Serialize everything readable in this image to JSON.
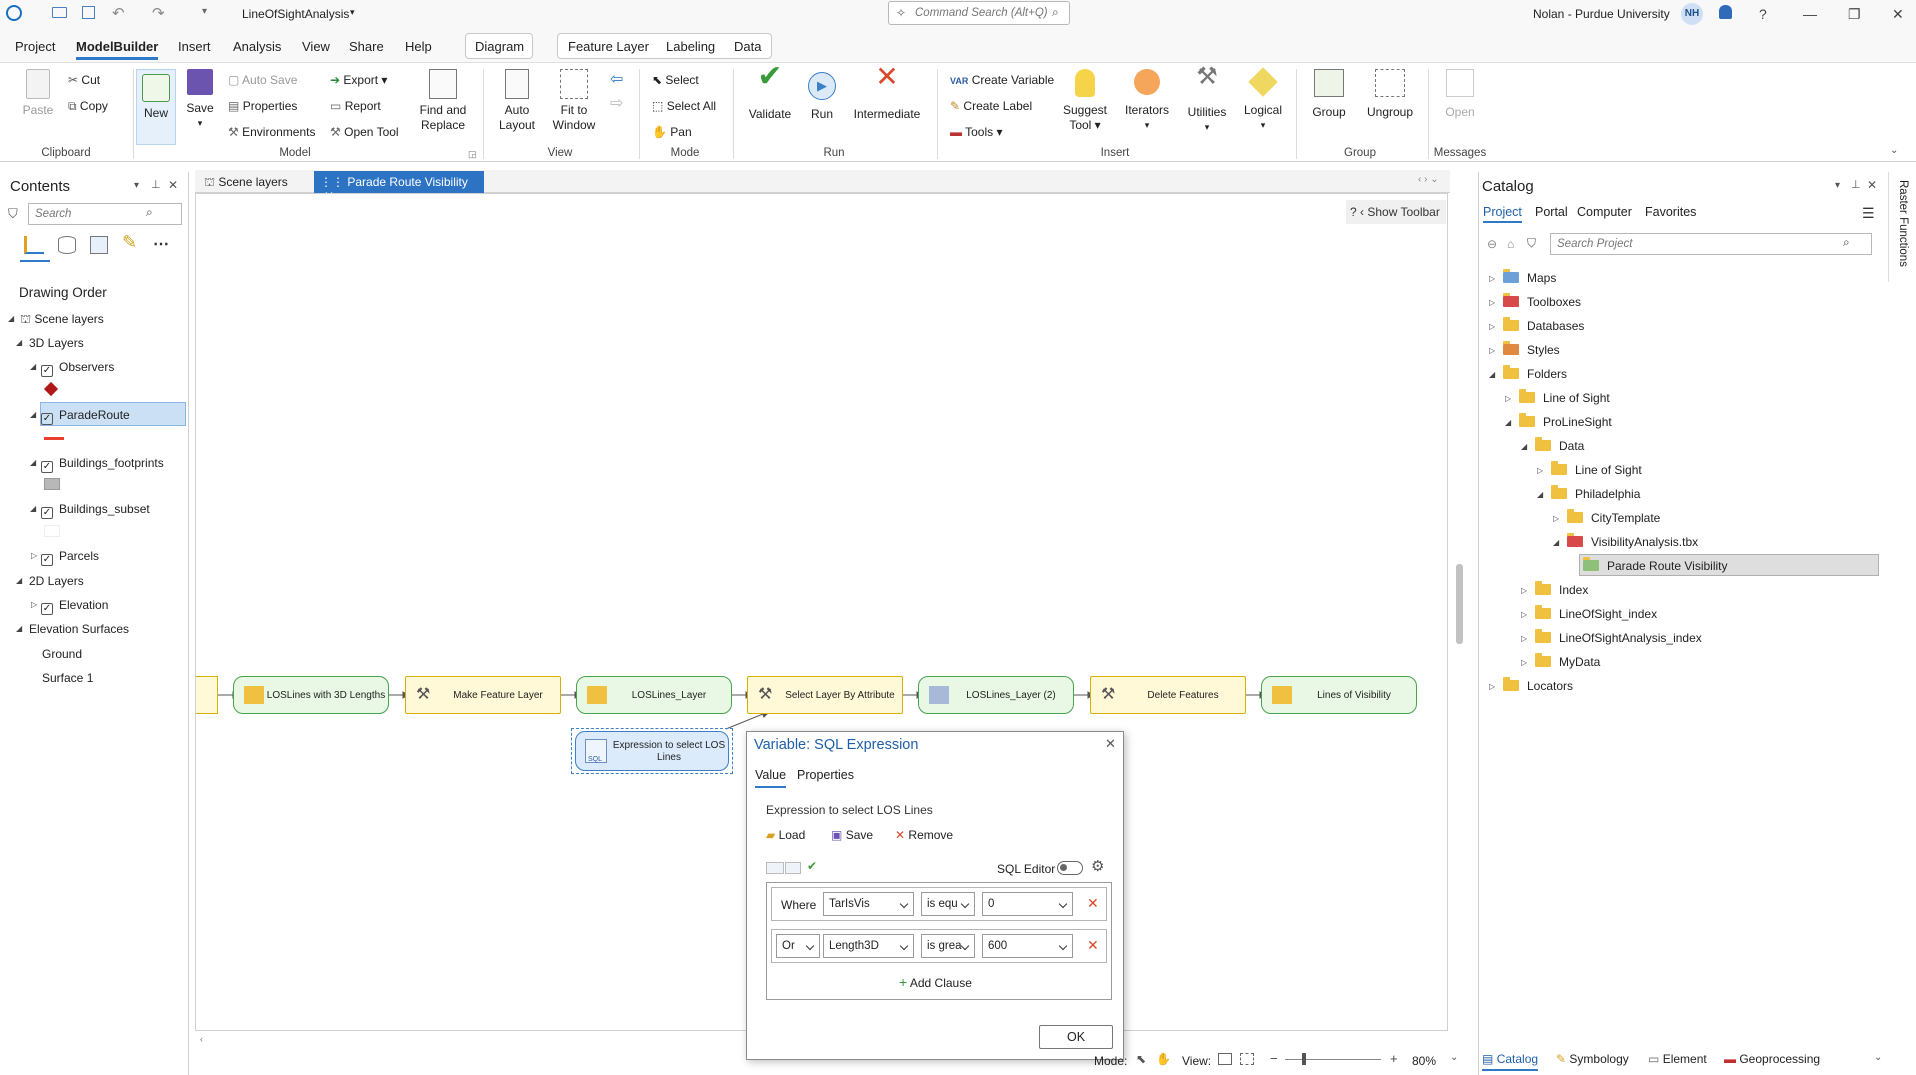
{
  "title": {
    "project": "LineOfSightAnalysis",
    "search_placeholder": "Command Search (Alt+Q)",
    "user": "Nolan - Purdue University",
    "initials": "NH"
  },
  "menus": [
    "Project",
    "ModelBuilder",
    "Insert",
    "Analysis",
    "View",
    "Share",
    "Help"
  ],
  "context_tabs": {
    "diagram": "Diagram",
    "feature_layer": "Feature Layer",
    "labeling": "Labeling",
    "data": "Data"
  },
  "ribbon": {
    "paste": "Paste",
    "cut": "Cut",
    "copy": "Copy",
    "clipboard": "Clipboard",
    "new": "New",
    "save": "Save",
    "auto_save": "Auto Save",
    "properties": "Properties",
    "environments": "Environments",
    "export": "Export",
    "report": "Report",
    "open_tool": "Open Tool",
    "find_replace_1": "Find and",
    "find_replace_2": "Replace",
    "model": "Model",
    "auto_layout_1": "Auto",
    "auto_layout_2": "Layout",
    "fit_1": "Fit to",
    "fit_2": "Window",
    "view": "View",
    "select": "Select",
    "select_all": "Select All",
    "pan": "Pan",
    "mode": "Mode",
    "validate": "Validate",
    "run": "Run",
    "intermediate": "Intermediate",
    "run_grp": "Run",
    "create_variable": "Create Variable",
    "create_label": "Create Label",
    "tools": "Tools",
    "suggest_1": "Suggest",
    "suggest_2": "Tool",
    "iterators": "Iterators",
    "utilities": "Utilities",
    "logical": "Logical",
    "insert": "Insert",
    "group": "Group",
    "ungroup": "Ungroup",
    "group_grp": "Group",
    "open": "Open",
    "messages": "Messages"
  },
  "contents": {
    "title": "Contents",
    "search": "Search",
    "drawing_order": "Drawing Order",
    "items": {
      "scene_layers": "Scene layers",
      "layers3d": "3D Layers",
      "observers": "Observers",
      "parade_route": "ParadeRoute",
      "footprints": "Buildings_footprints",
      "subset": "Buildings_subset",
      "parcels": "Parcels",
      "layers2d": "2D Layers",
      "elevation": "Elevation",
      "surfaces": "Elevation Surfaces",
      "ground": "Ground",
      "surface1": "Surface 1"
    }
  },
  "view_tabs": {
    "scene": "Scene layers",
    "model": "Parade Route Visibility"
  },
  "canvas": {
    "show_toolbar": "Show Toolbar",
    "nodes": [
      "LOSLines with 3D Lengths",
      "Make Feature Layer",
      "LOSLines_Layer",
      "Select Layer By Attribute",
      "LOSLines_Layer (2)",
      "Delete Features",
      "Lines of Visibility"
    ],
    "sql_node_1": "Expression to select LOS",
    "sql_node_2": "Lines",
    "sql_badge": "SQL"
  },
  "dialog": {
    "title": "Variable: SQL Expression",
    "tab_value": "Value",
    "tab_properties": "Properties",
    "label": "Expression to select LOS Lines",
    "load": "Load",
    "save": "Save",
    "remove": "Remove",
    "sql_editor": "SQL Editor",
    "clause1": {
      "op": "Where",
      "field": "TarIsVis",
      "cmp": "is equ",
      "val": "0"
    },
    "clause2": {
      "op": "Or",
      "field": "Length3D",
      "cmp": "is grea",
      "val": "600"
    },
    "add_clause": "Add Clause",
    "ok": "OK"
  },
  "catalog": {
    "title": "Catalog",
    "tabs": [
      "Project",
      "Portal",
      "Computer",
      "Favorites"
    ],
    "search": "Search Project",
    "items": {
      "maps": "Maps",
      "toolboxes": "Toolboxes",
      "databases": "Databases",
      "styles": "Styles",
      "folders": "Folders",
      "los": "Line of Sight",
      "pro": "ProLineSight",
      "data": "Data",
      "los2": "Line of Sight",
      "phila": "Philadelphia",
      "city": "CityTemplate",
      "tbx": "VisibilityAnalysis.tbx",
      "prv": "Parade Route Visibility",
      "index": "Index",
      "losi": "LineOfSight_index",
      "losai": "LineOfSightAnalysis_index",
      "mydata": "MyData",
      "locators": "Locators"
    }
  },
  "side_tab": "Raster Functions",
  "bottom": {
    "mode": "Mode:",
    "view": "View:",
    "zoom": "80%",
    "tabs": [
      "Catalog",
      "Symbology",
      "Element",
      "Geoprocessing"
    ]
  }
}
